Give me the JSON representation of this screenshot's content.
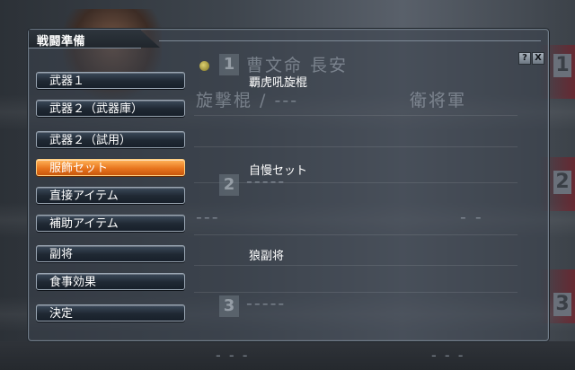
{
  "window": {
    "title": "戦闘準備",
    "help_label": "?",
    "close_label": "X"
  },
  "menu": [
    {
      "label": "武器１",
      "value": "覇虎吼旋棍",
      "active": false
    },
    {
      "label": "武器２（武器庫）",
      "value": "",
      "active": false
    },
    {
      "label": "武器２（試用）",
      "value": "",
      "active": false
    },
    {
      "label": "服飾セット",
      "value": "自慢セット",
      "active": true
    },
    {
      "label": "直接アイテム",
      "value": "",
      "active": false
    },
    {
      "label": "補助アイテム",
      "value": "",
      "active": false
    },
    {
      "label": "副将",
      "value": "狼副将",
      "active": false
    },
    {
      "label": "食事効果",
      "value": "",
      "active": false
    },
    {
      "label": "決定",
      "value": "",
      "active": false
    }
  ],
  "background": {
    "slot1_number": "1",
    "slot1_name": "曹文命 長安",
    "slot1_weapon": "旋撃棍 / ---",
    "slot1_rank": "衛将軍",
    "slot2_number": "2",
    "slot2_name": "-----",
    "slot2_weapon": "---",
    "slot2_rank": "- -",
    "slot3_number": "3",
    "slot3_name": "-----",
    "right_num_top": "1",
    "right_num_mid": "2",
    "right_num_bottom": "3",
    "lower_left": "- - -",
    "lower_right": "- - -"
  },
  "colors": {
    "active_button": "#e8761e",
    "button": "#1f2833",
    "panel_border": "#6f7b88",
    "text": "#ffffff"
  }
}
